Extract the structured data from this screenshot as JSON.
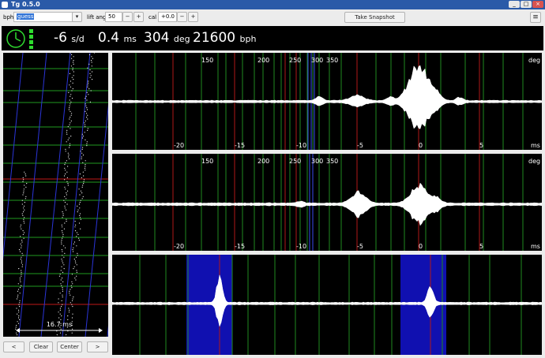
{
  "window": {
    "title": "Tg 0.5.0",
    "minimize": "_",
    "maximize": "□",
    "close": "×"
  },
  "toolbar": {
    "bph_label": "bph",
    "bph_value": "guess",
    "lift_angle_label": "lift angle",
    "lift_angle_value": "50",
    "cal_label": "cal",
    "cal_value": "+0.0",
    "minus": "−",
    "plus": "+",
    "snapshot": "Take Snapshot",
    "menu": "≡"
  },
  "status": {
    "rate": "-6",
    "rate_unit": "s/d",
    "beat_error": "0.4",
    "beat_error_unit": "ms",
    "amplitude": "304",
    "amplitude_unit": "deg",
    "bph": "21600",
    "bph_unit": "bph"
  },
  "paperstrip": {
    "scale_label": "16.7 ms"
  },
  "waveforms": {
    "deg_unit": "deg",
    "ms_unit": "ms",
    "deg_ticks": [
      "150",
      "200",
      "250",
      "300",
      "350"
    ],
    "ms_ticks": [
      "-20",
      "-15",
      "-10",
      "-5",
      "0",
      "5"
    ]
  },
  "bottom": {
    "prev": "<",
    "clear": "Clear",
    "center": "Center",
    "next": ">"
  }
}
